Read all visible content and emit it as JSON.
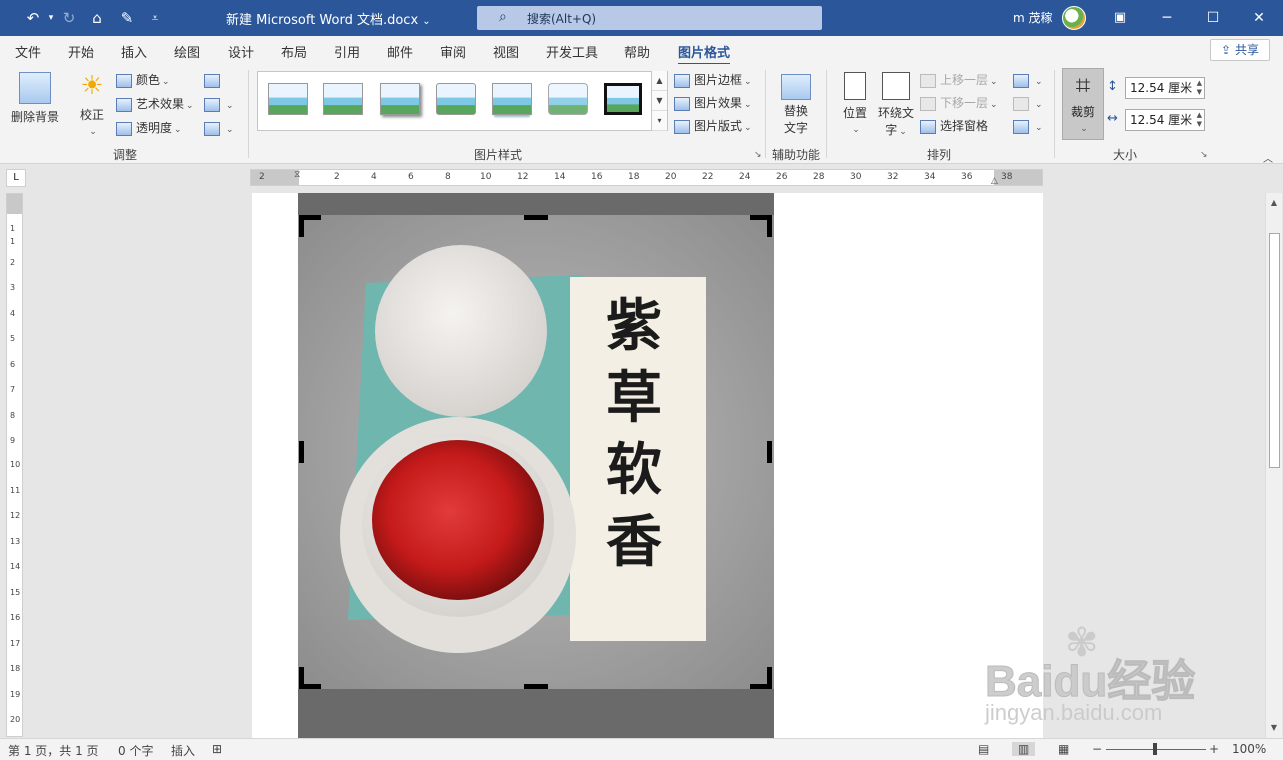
{
  "titlebar": {
    "doc_title": "新建 Microsoft Word 文档.docx",
    "search_placeholder": "搜索(Alt+Q)",
    "user_name": "m 茂稼",
    "accent": "#2b579a"
  },
  "tabs": [
    "文件",
    "开始",
    "插入",
    "绘图",
    "设计",
    "布局",
    "引用",
    "邮件",
    "审阅",
    "视图",
    "开发工具",
    "帮助",
    "图片格式"
  ],
  "active_tab": "图片格式",
  "share_label": "共享",
  "ribbon": {
    "adjust": {
      "remove_bg": "删除背景",
      "correct": "校正",
      "color": "颜色",
      "artistic": "艺术效果",
      "transparency": "透明度",
      "group_label": "调整"
    },
    "styles": {
      "border": "图片边框",
      "effects": "图片效果",
      "layout": "图片版式",
      "group_label": "图片样式"
    },
    "accessibility": {
      "alt_text_line1": "替换",
      "alt_text_line2": "文字",
      "group_label": "辅助功能"
    },
    "arrange": {
      "position": "位置",
      "wrap_line1": "环绕文",
      "wrap_line2": "字",
      "bring_forward": "上移一层",
      "send_backward": "下移一层",
      "selection_pane": "选择窗格",
      "group_label": "排列"
    },
    "size": {
      "crop": "裁剪",
      "height": "12.54 厘米",
      "width": "12.54 厘米",
      "group_label": "大小"
    }
  },
  "ruler": {
    "h_labels": [
      "2",
      "2",
      "4",
      "6",
      "8",
      "10",
      "12",
      "14",
      "16",
      "18",
      "20",
      "22",
      "24",
      "26",
      "28",
      "30",
      "32",
      "34",
      "36",
      "38"
    ],
    "v_labels": [
      "1",
      "1",
      "2",
      "3",
      "4",
      "5",
      "6",
      "7",
      "8",
      "9",
      "10",
      "11",
      "12",
      "13",
      "14",
      "15",
      "16",
      "17",
      "18",
      "19",
      "20"
    ]
  },
  "image": {
    "calligraphy": "紫草软香"
  },
  "watermark": {
    "brand": "Baidu经验",
    "url": "jingyan.baidu.com"
  },
  "statusbar": {
    "page": "第 1 页，共 1 页",
    "words": "0 个字",
    "mode": "插入",
    "zoom": "100%"
  }
}
